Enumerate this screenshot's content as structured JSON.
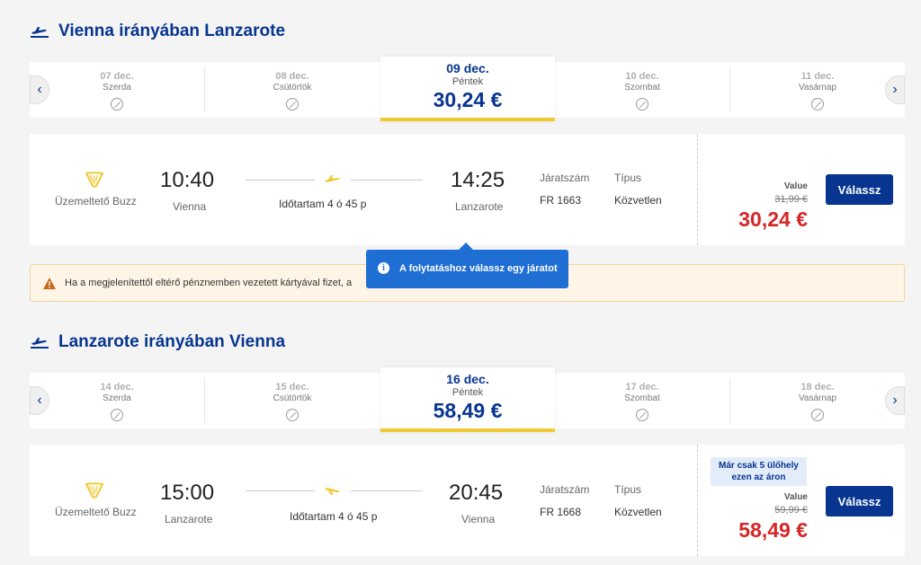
{
  "outbound": {
    "title": "Vienna irányában Lanzarote",
    "dates": [
      {
        "date": "07 dec.",
        "day": "Szerda"
      },
      {
        "date": "08 dec.",
        "day": "Csütörtök"
      },
      {
        "date": "09 dec.",
        "day": "Péntek",
        "price": "30,24 €"
      },
      {
        "date": "10 dec.",
        "day": "Szombat"
      },
      {
        "date": "11 dec.",
        "day": "Vasárnap"
      }
    ],
    "flight": {
      "operator": "Üzemeltető Buzz",
      "dep_time": "10:40",
      "dep_city": "Vienna",
      "arr_time": "14:25",
      "arr_city": "Lanzarote",
      "duration": "Időtartam 4 ó 45 p",
      "flight_no_label": "Járatszám",
      "flight_no": "FR 1663",
      "type_label": "Típus",
      "type": "Közvetlen",
      "fare_name": "Value",
      "old_price": "31,99 €",
      "price": "30,24 €",
      "select_label": "Válassz"
    }
  },
  "warning": {
    "text": "Ha a megjelenítettől eltérő pénznemben vezetett kártyával fizet, a"
  },
  "tooltip": {
    "text": "A folytatáshoz válassz egy járatot",
    "icon": "info-icon"
  },
  "inbound": {
    "title": "Lanzarote irányában Vienna",
    "dates": [
      {
        "date": "14 dec.",
        "day": "Szerda"
      },
      {
        "date": "15 dec.",
        "day": "Csütörtök"
      },
      {
        "date": "16 dec.",
        "day": "Péntek",
        "price": "58,49 €"
      },
      {
        "date": "17 dec.",
        "day": "Szombat"
      },
      {
        "date": "18 dec.",
        "day": "Vasárnap"
      }
    ],
    "flight": {
      "operator": "Üzemeltető Buzz",
      "dep_time": "15:00",
      "dep_city": "Lanzarote",
      "arr_time": "20:45",
      "arr_city": "Vienna",
      "duration": "Időtartam 4 ó 45 p",
      "flight_no_label": "Járatszám",
      "flight_no": "FR 1668",
      "type_label": "Típus",
      "type": "Közvetlen",
      "seats_badge": "Már csak 5 ülőhely ezen az áron",
      "fare_name": "Value",
      "old_price": "59,99 €",
      "price": "58,49 €",
      "select_label": "Válassz"
    }
  },
  "colors": {
    "brand_blue": "#073590",
    "accent_yellow": "#f1c933",
    "price_red": "#d52626",
    "tooltip_blue": "#1f6ed4"
  }
}
